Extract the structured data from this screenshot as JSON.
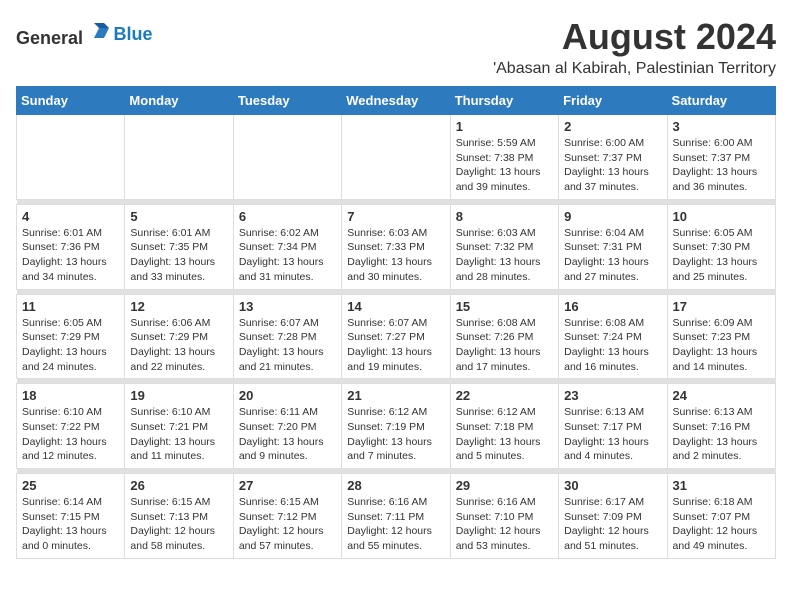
{
  "header": {
    "logo_general": "General",
    "logo_blue": "Blue",
    "month_year": "August 2024",
    "location": "'Abasan al Kabirah, Palestinian Territory"
  },
  "days_of_week": [
    "Sunday",
    "Monday",
    "Tuesday",
    "Wednesday",
    "Thursday",
    "Friday",
    "Saturday"
  ],
  "weeks": [
    [
      {
        "day": "",
        "sunrise": "",
        "sunset": "",
        "daylight": "",
        "empty": true
      },
      {
        "day": "",
        "sunrise": "",
        "sunset": "",
        "daylight": "",
        "empty": true
      },
      {
        "day": "",
        "sunrise": "",
        "sunset": "",
        "daylight": "",
        "empty": true
      },
      {
        "day": "",
        "sunrise": "",
        "sunset": "",
        "daylight": "",
        "empty": true
      },
      {
        "day": "1",
        "sunrise": "5:59 AM",
        "sunset": "7:38 PM",
        "daylight": "13 hours and 39 minutes."
      },
      {
        "day": "2",
        "sunrise": "6:00 AM",
        "sunset": "7:37 PM",
        "daylight": "13 hours and 37 minutes."
      },
      {
        "day": "3",
        "sunrise": "6:00 AM",
        "sunset": "7:37 PM",
        "daylight": "13 hours and 36 minutes."
      }
    ],
    [
      {
        "day": "4",
        "sunrise": "6:01 AM",
        "sunset": "7:36 PM",
        "daylight": "13 hours and 34 minutes."
      },
      {
        "day": "5",
        "sunrise": "6:01 AM",
        "sunset": "7:35 PM",
        "daylight": "13 hours and 33 minutes."
      },
      {
        "day": "6",
        "sunrise": "6:02 AM",
        "sunset": "7:34 PM",
        "daylight": "13 hours and 31 minutes."
      },
      {
        "day": "7",
        "sunrise": "6:03 AM",
        "sunset": "7:33 PM",
        "daylight": "13 hours and 30 minutes."
      },
      {
        "day": "8",
        "sunrise": "6:03 AM",
        "sunset": "7:32 PM",
        "daylight": "13 hours and 28 minutes."
      },
      {
        "day": "9",
        "sunrise": "6:04 AM",
        "sunset": "7:31 PM",
        "daylight": "13 hours and 27 minutes."
      },
      {
        "day": "10",
        "sunrise": "6:05 AM",
        "sunset": "7:30 PM",
        "daylight": "13 hours and 25 minutes."
      }
    ],
    [
      {
        "day": "11",
        "sunrise": "6:05 AM",
        "sunset": "7:29 PM",
        "daylight": "13 hours and 24 minutes."
      },
      {
        "day": "12",
        "sunrise": "6:06 AM",
        "sunset": "7:29 PM",
        "daylight": "13 hours and 22 minutes."
      },
      {
        "day": "13",
        "sunrise": "6:07 AM",
        "sunset": "7:28 PM",
        "daylight": "13 hours and 21 minutes."
      },
      {
        "day": "14",
        "sunrise": "6:07 AM",
        "sunset": "7:27 PM",
        "daylight": "13 hours and 19 minutes."
      },
      {
        "day": "15",
        "sunrise": "6:08 AM",
        "sunset": "7:26 PM",
        "daylight": "13 hours and 17 minutes."
      },
      {
        "day": "16",
        "sunrise": "6:08 AM",
        "sunset": "7:24 PM",
        "daylight": "13 hours and 16 minutes."
      },
      {
        "day": "17",
        "sunrise": "6:09 AM",
        "sunset": "7:23 PM",
        "daylight": "13 hours and 14 minutes."
      }
    ],
    [
      {
        "day": "18",
        "sunrise": "6:10 AM",
        "sunset": "7:22 PM",
        "daylight": "13 hours and 12 minutes."
      },
      {
        "day": "19",
        "sunrise": "6:10 AM",
        "sunset": "7:21 PM",
        "daylight": "13 hours and 11 minutes."
      },
      {
        "day": "20",
        "sunrise": "6:11 AM",
        "sunset": "7:20 PM",
        "daylight": "13 hours and 9 minutes."
      },
      {
        "day": "21",
        "sunrise": "6:12 AM",
        "sunset": "7:19 PM",
        "daylight": "13 hours and 7 minutes."
      },
      {
        "day": "22",
        "sunrise": "6:12 AM",
        "sunset": "7:18 PM",
        "daylight": "13 hours and 5 minutes."
      },
      {
        "day": "23",
        "sunrise": "6:13 AM",
        "sunset": "7:17 PM",
        "daylight": "13 hours and 4 minutes."
      },
      {
        "day": "24",
        "sunrise": "6:13 AM",
        "sunset": "7:16 PM",
        "daylight": "13 hours and 2 minutes."
      }
    ],
    [
      {
        "day": "25",
        "sunrise": "6:14 AM",
        "sunset": "7:15 PM",
        "daylight": "13 hours and 0 minutes."
      },
      {
        "day": "26",
        "sunrise": "6:15 AM",
        "sunset": "7:13 PM",
        "daylight": "12 hours and 58 minutes."
      },
      {
        "day": "27",
        "sunrise": "6:15 AM",
        "sunset": "7:12 PM",
        "daylight": "12 hours and 57 minutes."
      },
      {
        "day": "28",
        "sunrise": "6:16 AM",
        "sunset": "7:11 PM",
        "daylight": "12 hours and 55 minutes."
      },
      {
        "day": "29",
        "sunrise": "6:16 AM",
        "sunset": "7:10 PM",
        "daylight": "12 hours and 53 minutes."
      },
      {
        "day": "30",
        "sunrise": "6:17 AM",
        "sunset": "7:09 PM",
        "daylight": "12 hours and 51 minutes."
      },
      {
        "day": "31",
        "sunrise": "6:18 AM",
        "sunset": "7:07 PM",
        "daylight": "12 hours and 49 minutes."
      }
    ]
  ],
  "labels": {
    "sunrise": "Sunrise:",
    "sunset": "Sunset:",
    "daylight": "Daylight hours"
  }
}
